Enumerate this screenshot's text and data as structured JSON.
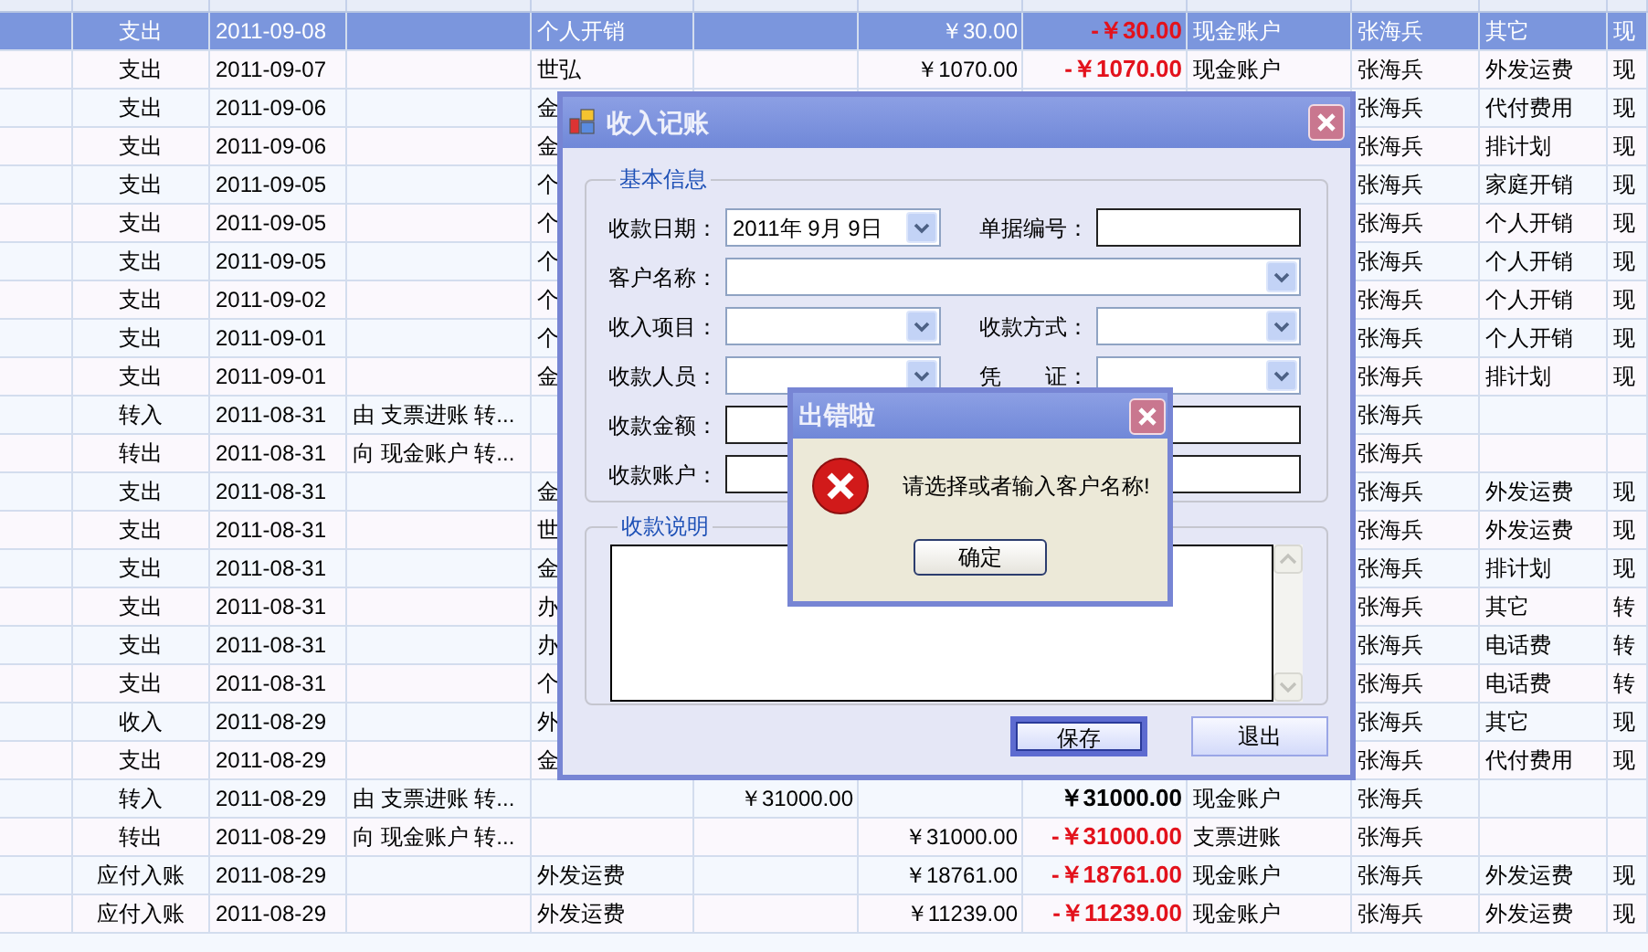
{
  "table": {
    "rows": [
      {
        "selected": true,
        "type": "支出",
        "date": "2011-09-08",
        "customer": "个人开销",
        "expense": "￥30.00",
        "total": {
          "text": "-￥30.00",
          "negative": true
        },
        "account": "现金账户",
        "handler": "张海兵",
        "subject": "其它",
        "column_12": "现"
      },
      {
        "selected": false,
        "type": "支出",
        "date": "2011-09-07",
        "customer": "世弘",
        "expense": "￥1070.00",
        "total": {
          "text": "-￥1070.00",
          "negative": true
        },
        "account": "现金账户",
        "handler": "张海兵",
        "subject": "外发运费",
        "column_12": "现"
      },
      {
        "selected": false,
        "type": "支出",
        "date": "2011-09-06",
        "customer": "金",
        "handler": "张海兵",
        "subject": "代付费用",
        "column_12": "现"
      },
      {
        "selected": false,
        "type": "支出",
        "date": "2011-09-06",
        "customer": "金",
        "handler": "张海兵",
        "subject": "排计划",
        "column_12": "现"
      },
      {
        "selected": false,
        "type": "支出",
        "date": "2011-09-05",
        "customer": "个",
        "handler": "张海兵",
        "subject": "家庭开销",
        "column_12": "现"
      },
      {
        "selected": false,
        "type": "支出",
        "date": "2011-09-05",
        "customer": "个",
        "handler": "张海兵",
        "subject": "个人开销",
        "column_12": "现"
      },
      {
        "selected": false,
        "type": "支出",
        "date": "2011-09-05",
        "customer": "个",
        "handler": "张海兵",
        "subject": "个人开销",
        "column_12": "现"
      },
      {
        "selected": false,
        "type": "支出",
        "date": "2011-09-02",
        "customer": "个",
        "handler": "张海兵",
        "subject": "个人开销",
        "column_12": "现"
      },
      {
        "selected": false,
        "type": "支出",
        "date": "2011-09-01",
        "customer": "个",
        "handler": "张海兵",
        "subject": "个人开销",
        "column_12": "现"
      },
      {
        "selected": false,
        "type": "支出",
        "date": "2011-09-01",
        "customer": "金",
        "handler": "张海兵",
        "subject": "排计划",
        "column_12": "现"
      },
      {
        "selected": false,
        "type": "转入",
        "date": "2011-08-31",
        "summary": "由 支票进账 转...",
        "handler": "张海兵"
      },
      {
        "selected": false,
        "type": "转出",
        "date": "2011-08-31",
        "summary": "向 现金账户 转...",
        "handler": "张海兵"
      },
      {
        "selected": false,
        "type": "支出",
        "date": "2011-08-31",
        "customer": "金",
        "handler": "张海兵",
        "subject": "外发运费",
        "column_12": "现"
      },
      {
        "selected": false,
        "type": "支出",
        "date": "2011-08-31",
        "customer": "世",
        "handler": "张海兵",
        "subject": "外发运费",
        "column_12": "现"
      },
      {
        "selected": false,
        "type": "支出",
        "date": "2011-08-31",
        "customer": "金",
        "handler": "张海兵",
        "subject": "排计划",
        "column_12": "现"
      },
      {
        "selected": false,
        "type": "支出",
        "date": "2011-08-31",
        "customer": "办",
        "handler": "张海兵",
        "subject": "其它",
        "column_12": "转"
      },
      {
        "selected": false,
        "type": "支出",
        "date": "2011-08-31",
        "customer": "办",
        "handler": "张海兵",
        "subject": "电话费",
        "column_12": "转"
      },
      {
        "selected": false,
        "type": "支出",
        "date": "2011-08-31",
        "customer": "个",
        "handler": "张海兵",
        "subject": "电话费",
        "column_12": "转"
      },
      {
        "selected": false,
        "type": "收入",
        "date": "2011-08-29",
        "customer": "外",
        "handler": "张海兵",
        "subject": "其它",
        "column_12": "现"
      },
      {
        "selected": false,
        "type": "支出",
        "date": "2011-08-29",
        "customer": "金",
        "handler": "张海兵",
        "subject": "代付费用",
        "column_12": "现"
      },
      {
        "selected": false,
        "type": "转入",
        "date": "2011-08-29",
        "summary": "由 支票进账 转...",
        "income": "￥31000.00",
        "total": {
          "text": "￥31000.00",
          "negative": false
        },
        "account": "现金账户",
        "handler": "张海兵"
      },
      {
        "selected": false,
        "type": "转出",
        "date": "2011-08-29",
        "summary": "向 现金账户 转...",
        "expense": "￥31000.00",
        "total": {
          "text": "-￥31000.00",
          "negative": true
        },
        "account": "支票进账",
        "handler": "张海兵"
      },
      {
        "selected": false,
        "type": "应付入账",
        "date": "2011-08-29",
        "customer": "外发运费",
        "expense": "￥18761.00",
        "total": {
          "text": "-￥18761.00",
          "negative": true
        },
        "account": "现金账户",
        "handler": "张海兵",
        "subject": "外发运费",
        "column_12": "现"
      },
      {
        "selected": false,
        "type": "应付入账",
        "date": "2011-08-29",
        "customer": "外发运费",
        "expense": "￥11239.00",
        "total": {
          "text": "-￥11239.00",
          "negative": true
        },
        "account": "现金账户",
        "handler": "张海兵",
        "subject": "外发运费",
        "column_12": "现"
      }
    ]
  },
  "income_dialog": {
    "title": "收入记账",
    "basic_group": {
      "title": "基本信息",
      "rows": [
        [
          {
            "label": "收款日期：",
            "kind": "date",
            "value": "2011年 9月 9日"
          },
          {
            "label": "单据编号：",
            "kind": "text"
          }
        ],
        [
          {
            "label": "客户名称：",
            "kind": "combo",
            "wide": true
          }
        ],
        [
          {
            "label": "收入项目：",
            "kind": "combo"
          },
          {
            "label": "收款方式：",
            "kind": "combo"
          }
        ],
        [
          {
            "label": "收款人员：",
            "kind": "combo"
          },
          {
            "label": "凭　　证：",
            "kind": "combo"
          }
        ],
        [
          {
            "label": "收款金额：",
            "kind": "text"
          },
          {
            "kind": "text"
          }
        ],
        [
          {
            "label": "收款账户：",
            "kind": "text"
          },
          {
            "kind": "text"
          }
        ]
      ]
    },
    "remarks_group": {
      "title": "收款说明"
    },
    "buttons": [
      {
        "label": "保存",
        "focused": true
      },
      {
        "label": "退出",
        "focused": false
      }
    ]
  },
  "error_dialog": {
    "title": "出错啦",
    "message": "请选择或者输入客户名称!",
    "button": "确定"
  }
}
